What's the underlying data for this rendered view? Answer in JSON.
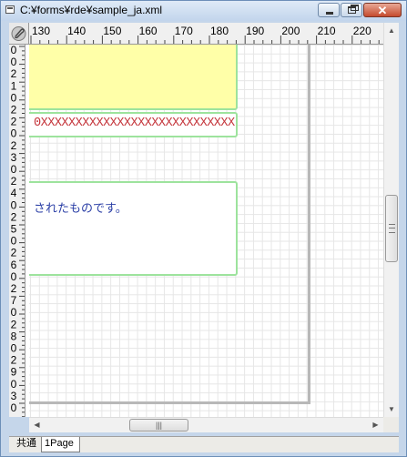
{
  "window": {
    "title": "C:¥forms¥rde¥sample_ja.xml",
    "minimize": "minimize",
    "maximize": "maximize",
    "close": "✕"
  },
  "ruler": {
    "h_labels": [
      "130",
      "140",
      "150",
      "160",
      "170",
      "180",
      "190",
      "200",
      "210",
      "220"
    ],
    "v_labels": [
      "0",
      "0",
      "2",
      "1",
      "0",
      "2",
      "2",
      "0",
      "2",
      "3",
      "0",
      "2",
      "4",
      "0",
      "2",
      "5",
      "0",
      "2",
      "6",
      "0",
      "2",
      "7",
      "0",
      "2",
      "8",
      "0",
      "2",
      "9",
      "0",
      "3",
      "0"
    ]
  },
  "canvas": {
    "repeat_text": "0XXXXXXXXXXXXXXXXXXXXXXXXXXXX",
    "body_text": "されたものです。"
  },
  "scrollbar": {
    "up": "▲",
    "down": "▼",
    "left": "◀",
    "right": "▶",
    "grip": "|||"
  },
  "tabs": [
    {
      "label": "共通"
    },
    {
      "label": "1Page"
    }
  ],
  "colors": {
    "selection_fill": "#ffffa8",
    "frame_green": "#9de39d",
    "text_red": "#c4343a",
    "text_blue": "#2b3fa6"
  }
}
